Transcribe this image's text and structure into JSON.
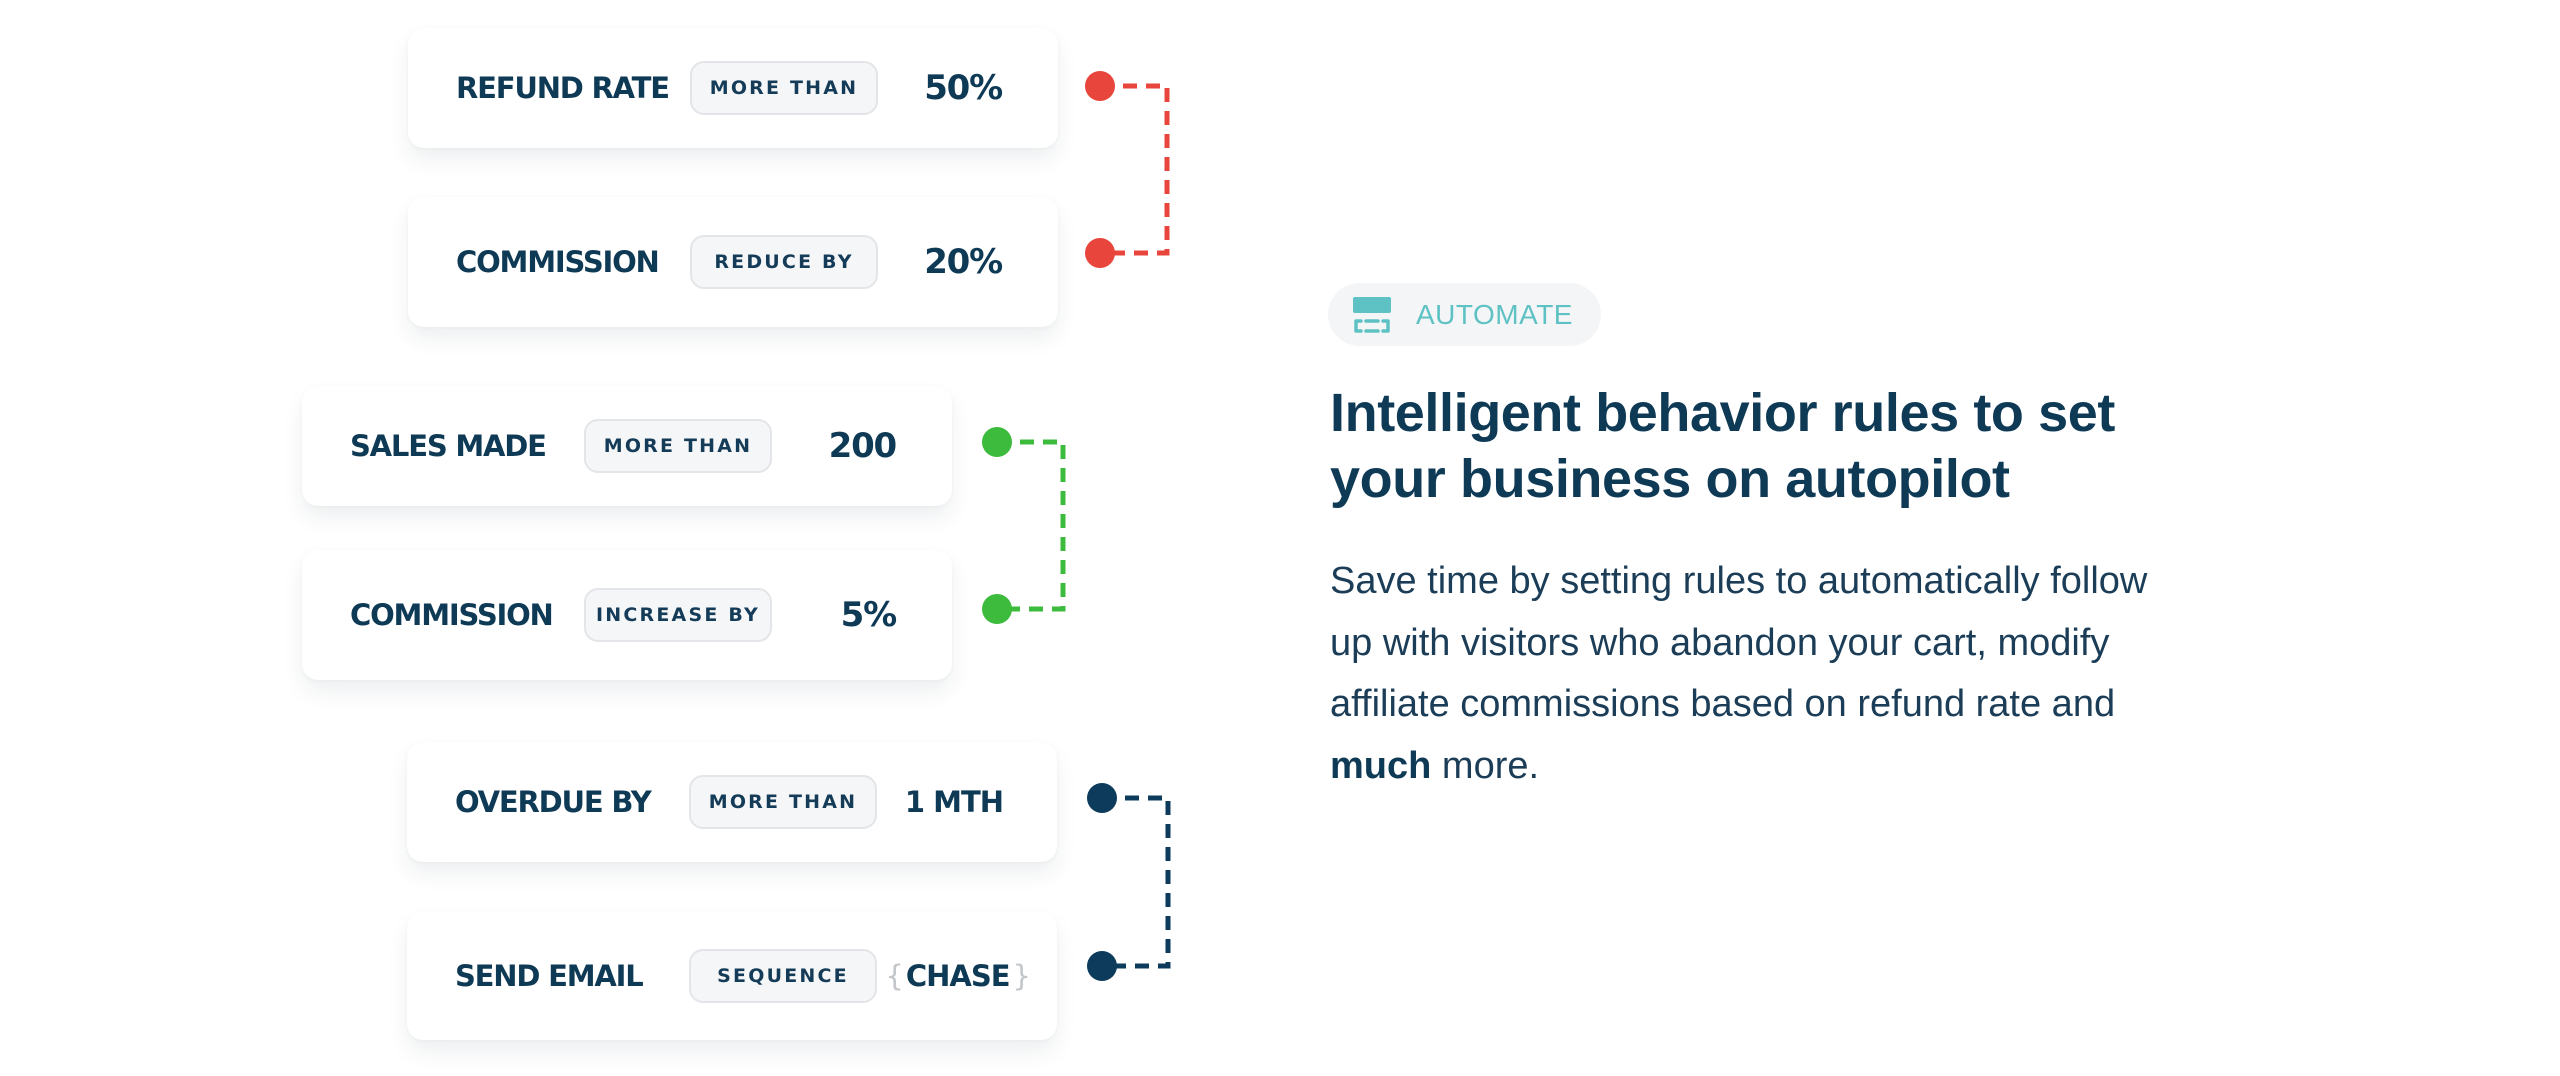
{
  "rule_groups": [
    {
      "color": "#e8453c",
      "rows": [
        {
          "label": "REFUND RATE",
          "operator": "MORE THAN",
          "value": "50%"
        },
        {
          "label": "COMMISSION",
          "operator": "REDUCE BY",
          "value": "20%"
        }
      ]
    },
    {
      "color": "#3dbb3d",
      "rows": [
        {
          "label": "SALES MADE",
          "operator": "MORE THAN",
          "value": "200"
        },
        {
          "label": "COMMISSION",
          "operator": "INCREASE BY",
          "value": "5%"
        }
      ]
    },
    {
      "color": "#0d3b5c",
      "rows": [
        {
          "label": "OVERDUE BY",
          "operator": "MORE THAN",
          "value": "1 MTH"
        },
        {
          "label": "SEND EMAIL",
          "operator": "SEQUENCE",
          "value": "CHASE",
          "brace_open": "{",
          "brace_close": "}"
        }
      ]
    }
  ],
  "feature": {
    "badge": {
      "icon": "layout-dashed-icon",
      "label": "AUTOMATE",
      "color": "#5ec2c4"
    },
    "headline_line1": "Intelligent behavior rules to set",
    "headline_line2": "your business on autopilot",
    "body_prefix": "Save time by setting rules to automatically follow up with visitors who abandon your cart, modify affiliate commissions based on refund rate and ",
    "body_emphasis": "much",
    "body_suffix": " more."
  }
}
